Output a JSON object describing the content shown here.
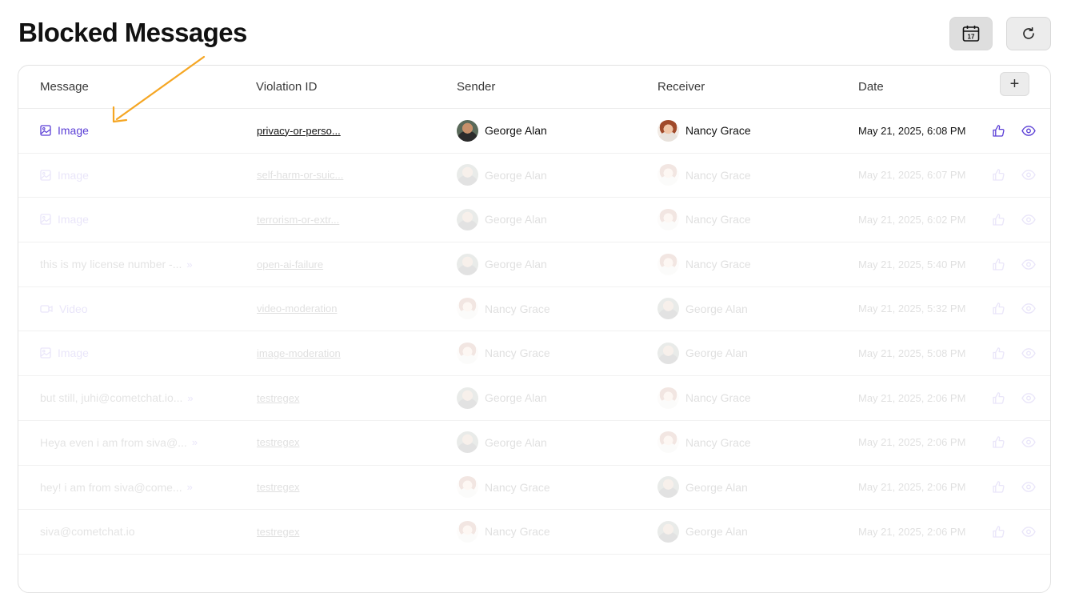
{
  "page": {
    "title": "Blocked Messages"
  },
  "toolbar": {
    "calendar_day": "17"
  },
  "table": {
    "columns": [
      "Message",
      "Violation ID",
      "Sender",
      "Receiver",
      "Date"
    ],
    "rows": [
      {
        "type": "image",
        "message": "Image",
        "violation": "privacy-or-perso...",
        "sender": "George Alan",
        "sender_avatar": "male",
        "receiver": "Nancy Grace",
        "receiver_avatar": "female",
        "date": "May 21, 2025, 6:08 PM"
      },
      {
        "type": "image",
        "message": "Image",
        "violation": "self-harm-or-suic...",
        "sender": "George Alan",
        "sender_avatar": "male",
        "receiver": "Nancy Grace",
        "receiver_avatar": "female",
        "date": "May 21, 2025, 6:07 PM"
      },
      {
        "type": "image",
        "message": "Image",
        "violation": "terrorism-or-extr...",
        "sender": "George Alan",
        "sender_avatar": "male",
        "receiver": "Nancy Grace",
        "receiver_avatar": "female",
        "date": "May 21, 2025, 6:02 PM"
      },
      {
        "type": "text-more",
        "message": "this is my license number -...",
        "violation": "open-ai-failure",
        "sender": "George Alan",
        "sender_avatar": "male",
        "receiver": "Nancy Grace",
        "receiver_avatar": "female",
        "date": "May 21, 2025, 5:40 PM"
      },
      {
        "type": "video",
        "message": "Video",
        "violation": "video-moderation",
        "sender": "Nancy Grace",
        "sender_avatar": "female",
        "receiver": "George Alan",
        "receiver_avatar": "male",
        "date": "May 21, 2025, 5:32 PM"
      },
      {
        "type": "image",
        "message": "Image",
        "violation": "image-moderation",
        "sender": "Nancy Grace",
        "sender_avatar": "female",
        "receiver": "George Alan",
        "receiver_avatar": "male",
        "date": "May 21, 2025, 5:08 PM"
      },
      {
        "type": "text-more",
        "message": "but still, juhi@cometchat.io...",
        "violation": "testregex",
        "sender": "George Alan",
        "sender_avatar": "male",
        "receiver": "Nancy Grace",
        "receiver_avatar": "female",
        "date": "May 21, 2025, 2:06 PM"
      },
      {
        "type": "text-more",
        "message": "Heya even i am from siva@...",
        "violation": "testregex",
        "sender": "George Alan",
        "sender_avatar": "male",
        "receiver": "Nancy Grace",
        "receiver_avatar": "female",
        "date": "May 21, 2025, 2:06 PM"
      },
      {
        "type": "text-more",
        "message": "hey! i am from siva@come...",
        "violation": "testregex",
        "sender": "Nancy Grace",
        "sender_avatar": "female",
        "receiver": "George Alan",
        "receiver_avatar": "male",
        "date": "May 21, 2025, 2:06 PM"
      },
      {
        "type": "text",
        "message": "siva@cometchat.io",
        "violation": "testregex",
        "sender": "Nancy Grace",
        "sender_avatar": "female",
        "receiver": "George Alan",
        "receiver_avatar": "male",
        "date": "May 21, 2025, 2:06 PM"
      }
    ]
  },
  "colors": {
    "accent": "#5b3fd6",
    "annotation_arrow": "#f5a623"
  }
}
